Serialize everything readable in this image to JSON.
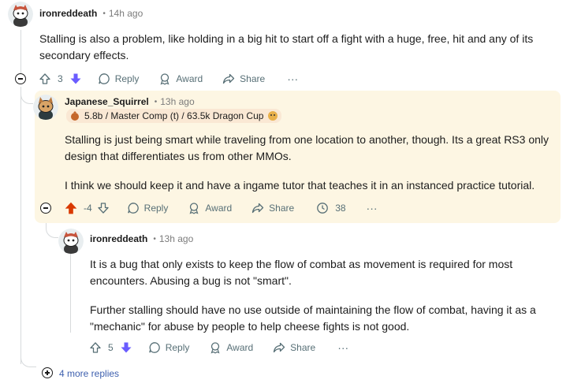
{
  "comment1": {
    "author": "ironreddeath",
    "time": "14h ago",
    "paragraphs": [
      "Stalling is also a problem, like holding in a big hit to start off a fight with a huge, free, hit and any of its secondary effects."
    ],
    "score": "3",
    "actions": {
      "reply": "Reply",
      "award": "Award",
      "share": "Share"
    }
  },
  "comment2": {
    "author": "Japanese_Squirrel",
    "time": "13h ago",
    "flair": "5.8b / Master Comp (t) / 63.5k Dragon Cup",
    "paragraphs": [
      "Stalling is just being smart while traveling from one location to another, though. Its a great RS3 only design that differentiates us from other MMOs.",
      "I think we should keep it and have a ingame tutor that teaches it in an instanced practice tutorial."
    ],
    "score": "-4",
    "actions": {
      "reply": "Reply",
      "award": "Award",
      "share": "Share",
      "awards_count": "38"
    }
  },
  "comment3": {
    "author": "ironreddeath",
    "time": "13h ago",
    "paragraphs": [
      "It is a bug that only exists to keep the flow of combat as movement is required for most encounters. Abusing a bug is not \"smart\".",
      "Further stalling should have no use outside of maintaining the flow of combat, having it as a \"mechanic\" for abuse by people to help cheese fights is not good."
    ],
    "score": "5",
    "actions": {
      "reply": "Reply",
      "award": "Award",
      "share": "Share"
    }
  },
  "more_replies": "4 more replies",
  "colors": {
    "upvote": "#d93900",
    "downvote": "#6a5cff",
    "highlight": "#fdf6e3",
    "link": "#3d5fae"
  }
}
